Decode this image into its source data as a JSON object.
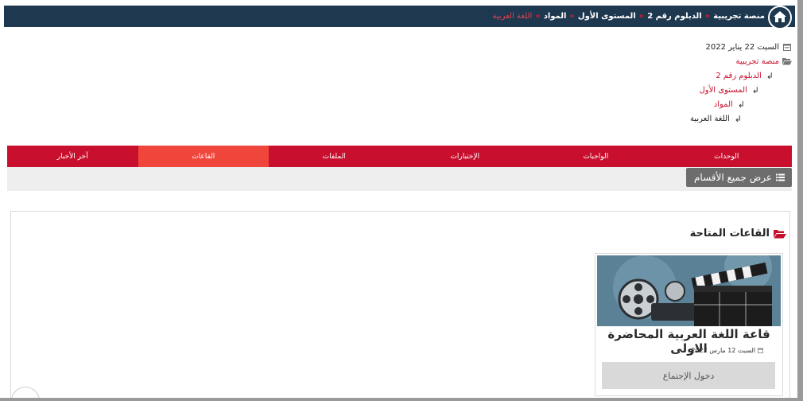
{
  "breadcrumb": {
    "items": [
      {
        "label": "منصة تجريبية"
      },
      {
        "label": "الدبلوم رقم 2"
      },
      {
        "label": "المستوى الأول"
      },
      {
        "label": "المواد"
      },
      {
        "label": "اللغة العربية",
        "active": true
      }
    ]
  },
  "info": {
    "date": "السبت 22 يناير 2022",
    "tree": [
      {
        "label": "منصة تجريبية",
        "level": 0
      },
      {
        "label": "الدبلوم رقم 2",
        "level": 1
      },
      {
        "label": "المستوى الأول",
        "level": 2
      },
      {
        "label": "المواد",
        "level": 3
      },
      {
        "label": "اللغة العربية",
        "level": 4
      }
    ]
  },
  "tabs": [
    {
      "label": "الوحدات",
      "active": false
    },
    {
      "label": "الواجبات",
      "active": false
    },
    {
      "label": "الإختبارات",
      "active": false
    },
    {
      "label": "الملفات",
      "active": false
    },
    {
      "label": "القاعات",
      "active": true
    },
    {
      "label": "آخر الأخبار",
      "active": false
    }
  ],
  "show_all": {
    "label": "عرض جميع الأقسام"
  },
  "rooms": {
    "title": "القاعات المتاحة",
    "card": {
      "title": "قاعة اللغة العربية المحاضرة الاولى",
      "date": "السبت 12 مارس 2022",
      "button": "دخول الإجتماع",
      "image_caption": "movie-reel-clapperboard"
    }
  },
  "colors": {
    "navy": "#1e384f",
    "red": "#c8102e",
    "active_tab": "#f0453b",
    "button_gray": "#6d6d6d"
  },
  "icons": {
    "home": "home-icon",
    "calendar": "calendar-icon",
    "folder": "folder-open-icon",
    "list": "list-icon",
    "scroll_top": "chevron-up-icon"
  }
}
